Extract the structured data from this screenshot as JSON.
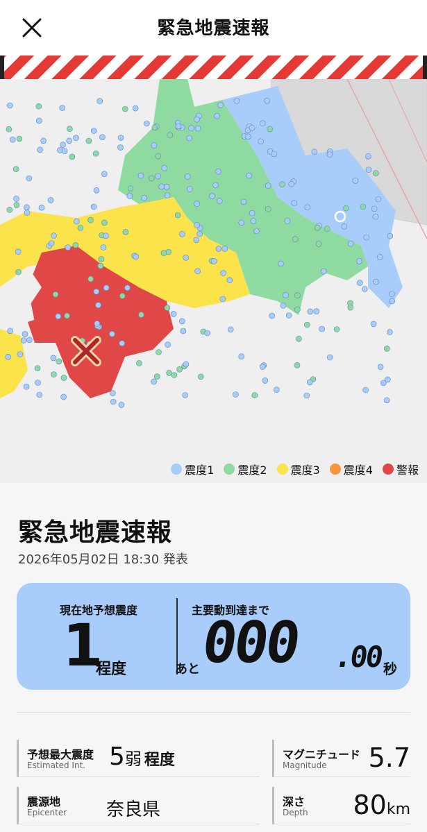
{
  "header": {
    "title": "緊急地震速報",
    "close_icon": "close-icon"
  },
  "legend": {
    "items": [
      {
        "label": "震度1",
        "color": "#a9cdfb"
      },
      {
        "label": "震度2",
        "color": "#8fdaa0"
      },
      {
        "label": "震度3",
        "color": "#fbe34c"
      },
      {
        "label": "震度4",
        "color": "#f9943b"
      },
      {
        "label": "警報",
        "color": "#e04848"
      }
    ]
  },
  "map": {
    "epicenter_icon": "epicenter-x-icon",
    "current_location_icon": "current-location-icon"
  },
  "info": {
    "title": "緊急地震速報",
    "issued": "2026年05月02日 18:30 発表"
  },
  "card": {
    "local_label": "現在地予想震度",
    "local_value": "1",
    "local_unit": "程度",
    "arrival_label": "主要動到達まで",
    "arrival_prefix": "あと",
    "countdown_main": "000",
    "countdown_dec": ".00",
    "countdown_unit": "秒",
    "color": "#a9cdfb"
  },
  "stats": {
    "max_intensity": {
      "label_jp": "予想最大震度",
      "label_en": "Estimated Int.",
      "value": "5",
      "suffix": "弱",
      "unit": "程度"
    },
    "magnitude": {
      "label_jp": "マグニチュード",
      "label_en": "Magnitude",
      "value": "5.7"
    },
    "epicenter": {
      "label_jp": "震源地",
      "label_en": "Epicenter",
      "value": "奈良県"
    },
    "depth": {
      "label_jp": "深さ",
      "label_en": "Depth",
      "value": "80",
      "unit": "km"
    }
  }
}
